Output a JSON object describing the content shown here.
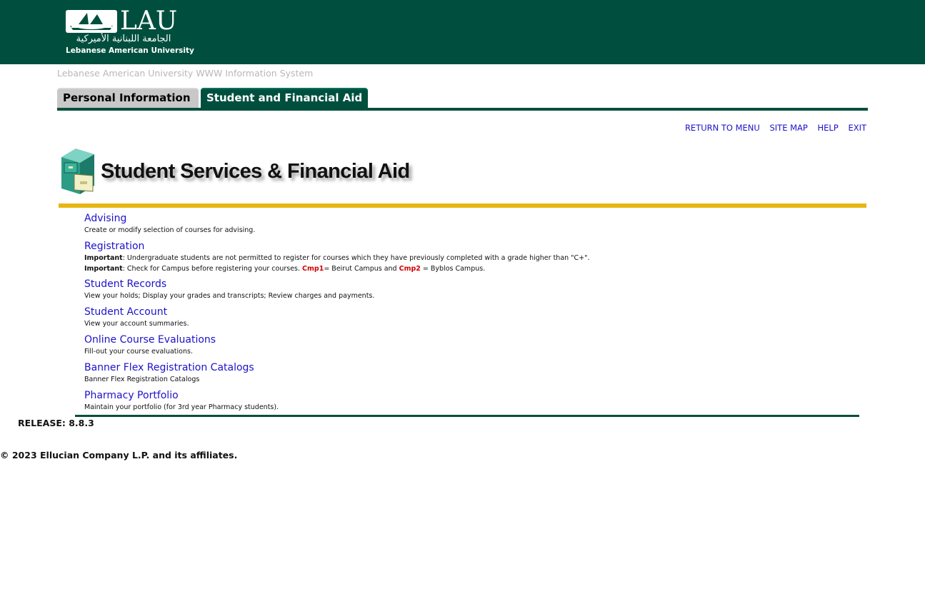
{
  "header": {
    "logo_text": "LAU",
    "logo_arabic": "الجامعة اللبنانية الأميركية",
    "logo_subtitle": "Lebanese American University",
    "system_name": "Lebanese American University WWW Information System"
  },
  "tabs": [
    {
      "label": "Personal Information",
      "active": false
    },
    {
      "label": "Student and Financial Aid",
      "active": true
    }
  ],
  "top_links": {
    "return_to_menu": "RETURN TO MENU",
    "site_map": "SITE MAP",
    "help": "HELP",
    "exit": "EXIT"
  },
  "page": {
    "title": "Student Services & Financial Aid",
    "icon": "file-cabinet-icon"
  },
  "menu": [
    {
      "label": "Advising",
      "desc": "Create or modify selection of courses for advising."
    },
    {
      "label": "Registration",
      "note1_prefix": "Important",
      "note1_text": ": Undergraduate students are not permitted to register for courses which they have previously completed with a grade higher than \"C+\".",
      "note2_prefix": "Important",
      "note2_text1": ": Check for Campus before registering your courses. ",
      "note2_cmp1": "Cmp1",
      "note2_text2": "= Beirut Campus and ",
      "note2_cmp2": "Cmp2",
      "note2_text3": " = Byblos Campus."
    },
    {
      "label": "Student Records",
      "desc": "View your holds; Display your grades and transcripts; Review charges and payments."
    },
    {
      "label": "Student Account",
      "desc": "View your account summaries."
    },
    {
      "label": "Online Course Evaluations",
      "desc": "Fill-out your course evaluations."
    },
    {
      "label": "Banner Flex Registration Catalogs",
      "desc": "Banner Flex Registration Catalogs"
    },
    {
      "label": "Pharmacy Portfolio",
      "desc": "Maintain your portfolio (for 3rd year Pharmacy students)."
    }
  ],
  "footer": {
    "release": "RELEASE: 8.8.3",
    "copyright": "© 2023 Ellucian Company L.P. and its affiliates."
  },
  "colors": {
    "brand_green": "#004f3e",
    "gold_rule": "#e6b612",
    "link_blue": "#1c12c9",
    "campus_red": "#d40000"
  }
}
